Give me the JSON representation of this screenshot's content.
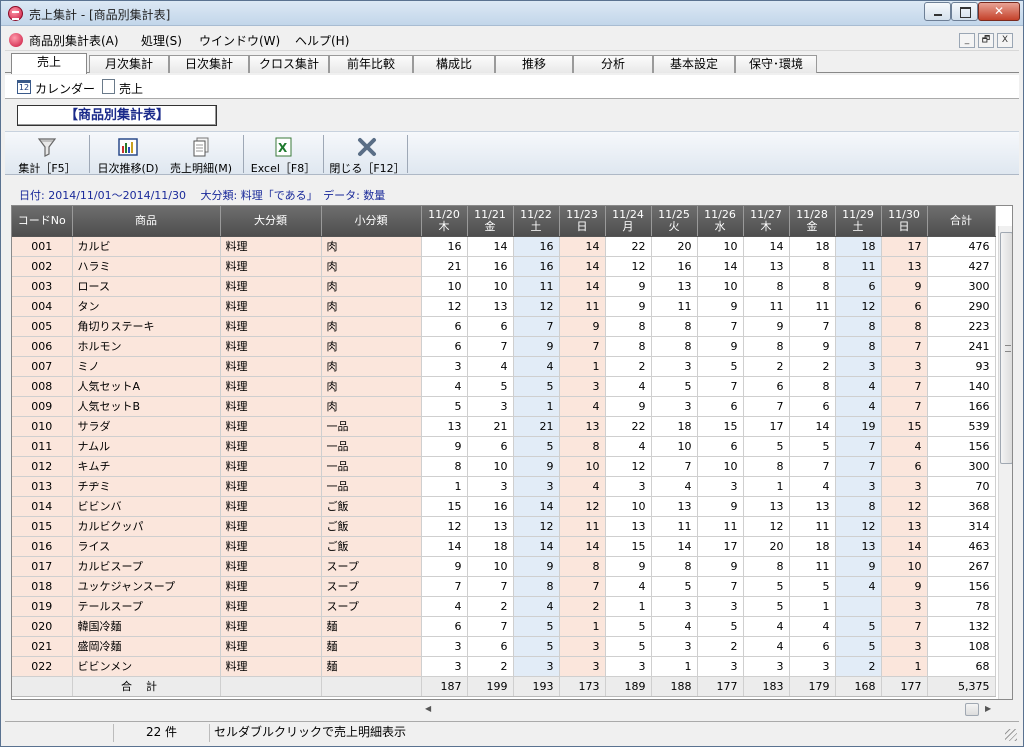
{
  "window": {
    "title": "売上集計 - [商品別集計表]"
  },
  "menu": {
    "items": [
      "商品別集計表(A)",
      "処理(S)",
      "ウインドウ(W)",
      "ヘルプ(H)"
    ],
    "mdi_buttons": [
      "_",
      "🗗",
      "X"
    ]
  },
  "tabs": [
    "売上",
    "月次集計",
    "日次集計",
    "クロス集計",
    "前年比較",
    "構成比",
    "推移",
    "分析",
    "基本設定",
    "保守･環境"
  ],
  "subbar": {
    "calendar_icon_text": "12",
    "calendar_label": "カレンダー",
    "sales_label": "売上"
  },
  "report_title": "【商品別集計表】",
  "toolbar": {
    "tools": [
      {
        "id": "aggregate",
        "label": "集計［F5］",
        "icon": "funnel-icon"
      },
      {
        "id": "daily-trend",
        "label": "日次推移(D)",
        "icon": "bar-chart-icon"
      },
      {
        "id": "sales-detail",
        "label": "売上明細(M)",
        "icon": "documents-icon"
      },
      {
        "id": "excel",
        "label": "Excel［F8］",
        "icon": "excel-icon"
      },
      {
        "id": "close",
        "label": "閉じる［F12］",
        "icon": "close-x-icon"
      }
    ]
  },
  "filter": {
    "text": "日付: 2014/11/01～2014/11/30　 大分類: 料理「である」　データ: 数量"
  },
  "grid": {
    "headers": {
      "code": "コードNo",
      "product": "商品",
      "major": "大分類",
      "minor": "小分類",
      "total": "合計"
    },
    "days": [
      {
        "date": "11/20",
        "dow": "木",
        "type": "weekday"
      },
      {
        "date": "11/21",
        "dow": "金",
        "type": "weekday"
      },
      {
        "date": "11/22",
        "dow": "土",
        "type": "sat"
      },
      {
        "date": "11/23",
        "dow": "日",
        "type": "sun"
      },
      {
        "date": "11/24",
        "dow": "月",
        "type": "weekday"
      },
      {
        "date": "11/25",
        "dow": "火",
        "type": "weekday"
      },
      {
        "date": "11/26",
        "dow": "水",
        "type": "weekday"
      },
      {
        "date": "11/27",
        "dow": "木",
        "type": "weekday"
      },
      {
        "date": "11/28",
        "dow": "金",
        "type": "weekday"
      },
      {
        "date": "11/29",
        "dow": "土",
        "type": "sat"
      },
      {
        "date": "11/30",
        "dow": "日",
        "type": "sun"
      }
    ],
    "rows": [
      {
        "code": "001",
        "product": "カルビ",
        "major": "料理",
        "minor": "肉",
        "values": [
          "16",
          "14",
          "16",
          "14",
          "22",
          "20",
          "10",
          "14",
          "18",
          "18",
          "17"
        ],
        "total": "476"
      },
      {
        "code": "002",
        "product": "ハラミ",
        "major": "料理",
        "minor": "肉",
        "values": [
          "21",
          "16",
          "16",
          "14",
          "12",
          "16",
          "14",
          "13",
          "8",
          "11",
          "13"
        ],
        "total": "427"
      },
      {
        "code": "003",
        "product": "ロース",
        "major": "料理",
        "minor": "肉",
        "values": [
          "10",
          "10",
          "11",
          "14",
          "9",
          "13",
          "10",
          "8",
          "8",
          "6",
          "9"
        ],
        "total": "300"
      },
      {
        "code": "004",
        "product": "タン",
        "major": "料理",
        "minor": "肉",
        "values": [
          "12",
          "13",
          "12",
          "11",
          "9",
          "11",
          "9",
          "11",
          "11",
          "12",
          "6"
        ],
        "total": "290"
      },
      {
        "code": "005",
        "product": "角切りステーキ",
        "major": "料理",
        "minor": "肉",
        "values": [
          "6",
          "6",
          "7",
          "9",
          "8",
          "8",
          "7",
          "9",
          "7",
          "8",
          "8"
        ],
        "total": "223"
      },
      {
        "code": "006",
        "product": "ホルモン",
        "major": "料理",
        "minor": "肉",
        "values": [
          "6",
          "7",
          "9",
          "7",
          "8",
          "8",
          "9",
          "8",
          "9",
          "8",
          "7"
        ],
        "total": "241"
      },
      {
        "code": "007",
        "product": "ミノ",
        "major": "料理",
        "minor": "肉",
        "values": [
          "3",
          "4",
          "4",
          "1",
          "2",
          "3",
          "5",
          "2",
          "2",
          "3",
          "3"
        ],
        "total": "93"
      },
      {
        "code": "008",
        "product": "人気セットA",
        "major": "料理",
        "minor": "肉",
        "values": [
          "4",
          "5",
          "5",
          "3",
          "4",
          "5",
          "7",
          "6",
          "8",
          "4",
          "7"
        ],
        "total": "140"
      },
      {
        "code": "009",
        "product": "人気セットB",
        "major": "料理",
        "minor": "肉",
        "values": [
          "5",
          "3",
          "1",
          "4",
          "9",
          "3",
          "6",
          "7",
          "6",
          "4",
          "7"
        ],
        "total": "166"
      },
      {
        "code": "010",
        "product": "サラダ",
        "major": "料理",
        "minor": "一品",
        "values": [
          "13",
          "21",
          "21",
          "13",
          "22",
          "18",
          "15",
          "17",
          "14",
          "19",
          "15"
        ],
        "total": "539"
      },
      {
        "code": "011",
        "product": "ナムル",
        "major": "料理",
        "minor": "一品",
        "values": [
          "9",
          "6",
          "5",
          "8",
          "4",
          "10",
          "6",
          "5",
          "5",
          "7",
          "4"
        ],
        "total": "156"
      },
      {
        "code": "012",
        "product": "キムチ",
        "major": "料理",
        "minor": "一品",
        "values": [
          "8",
          "10",
          "9",
          "10",
          "12",
          "7",
          "10",
          "8",
          "7",
          "7",
          "6"
        ],
        "total": "300"
      },
      {
        "code": "013",
        "product": "チヂミ",
        "major": "料理",
        "minor": "一品",
        "values": [
          "1",
          "3",
          "3",
          "4",
          "3",
          "4",
          "3",
          "1",
          "4",
          "3",
          "3"
        ],
        "total": "70"
      },
      {
        "code": "014",
        "product": "ビビンバ",
        "major": "料理",
        "minor": "ご飯",
        "values": [
          "15",
          "16",
          "14",
          "12",
          "10",
          "13",
          "9",
          "13",
          "13",
          "8",
          "12"
        ],
        "total": "368"
      },
      {
        "code": "015",
        "product": "カルビクッパ",
        "major": "料理",
        "minor": "ご飯",
        "values": [
          "12",
          "13",
          "12",
          "11",
          "13",
          "11",
          "11",
          "12",
          "11",
          "12",
          "13"
        ],
        "total": "314"
      },
      {
        "code": "016",
        "product": "ライス",
        "major": "料理",
        "minor": "ご飯",
        "values": [
          "14",
          "18",
          "14",
          "14",
          "15",
          "14",
          "17",
          "20",
          "18",
          "13",
          "14"
        ],
        "total": "463"
      },
      {
        "code": "017",
        "product": "カルビスープ",
        "major": "料理",
        "minor": "スープ",
        "values": [
          "9",
          "10",
          "9",
          "8",
          "9",
          "8",
          "9",
          "8",
          "11",
          "9",
          "10"
        ],
        "total": "267"
      },
      {
        "code": "018",
        "product": "ユッケジャンスープ",
        "major": "料理",
        "minor": "スープ",
        "values": [
          "7",
          "7",
          "8",
          "7",
          "4",
          "5",
          "7",
          "5",
          "5",
          "4",
          "9"
        ],
        "total": "156"
      },
      {
        "code": "019",
        "product": "テールスープ",
        "major": "料理",
        "minor": "スープ",
        "values": [
          "4",
          "2",
          "4",
          "2",
          "1",
          "3",
          "3",
          "5",
          "1",
          "",
          "3"
        ],
        "total": "78"
      },
      {
        "code": "020",
        "product": "韓国冷麺",
        "major": "料理",
        "minor": "麺",
        "values": [
          "6",
          "7",
          "5",
          "1",
          "5",
          "4",
          "5",
          "4",
          "4",
          "5",
          "7"
        ],
        "total": "132"
      },
      {
        "code": "021",
        "product": "盛岡冷麺",
        "major": "料理",
        "minor": "麺",
        "values": [
          "3",
          "6",
          "5",
          "3",
          "5",
          "3",
          "2",
          "4",
          "6",
          "5",
          "3"
        ],
        "total": "108"
      },
      {
        "code": "022",
        "product": "ビビンメン",
        "major": "料理",
        "minor": "麺",
        "values": [
          "3",
          "2",
          "3",
          "3",
          "3",
          "1",
          "3",
          "3",
          "3",
          "2",
          "1"
        ],
        "total": "68"
      }
    ],
    "total_row": {
      "label": "合計",
      "values": [
        "187",
        "199",
        "193",
        "173",
        "189",
        "188",
        "177",
        "183",
        "179",
        "168",
        "177"
      ],
      "total": "5,375"
    }
  },
  "status": {
    "count": "22 件",
    "message": "セルダブルクリックで売上明細表示"
  },
  "colors": {
    "text_column_bg": "#fbe6dc",
    "saturday_bg": "#e2ecf7",
    "sunday_bg": "#fbe6dc",
    "header_bg": "#5e5e5e"
  }
}
